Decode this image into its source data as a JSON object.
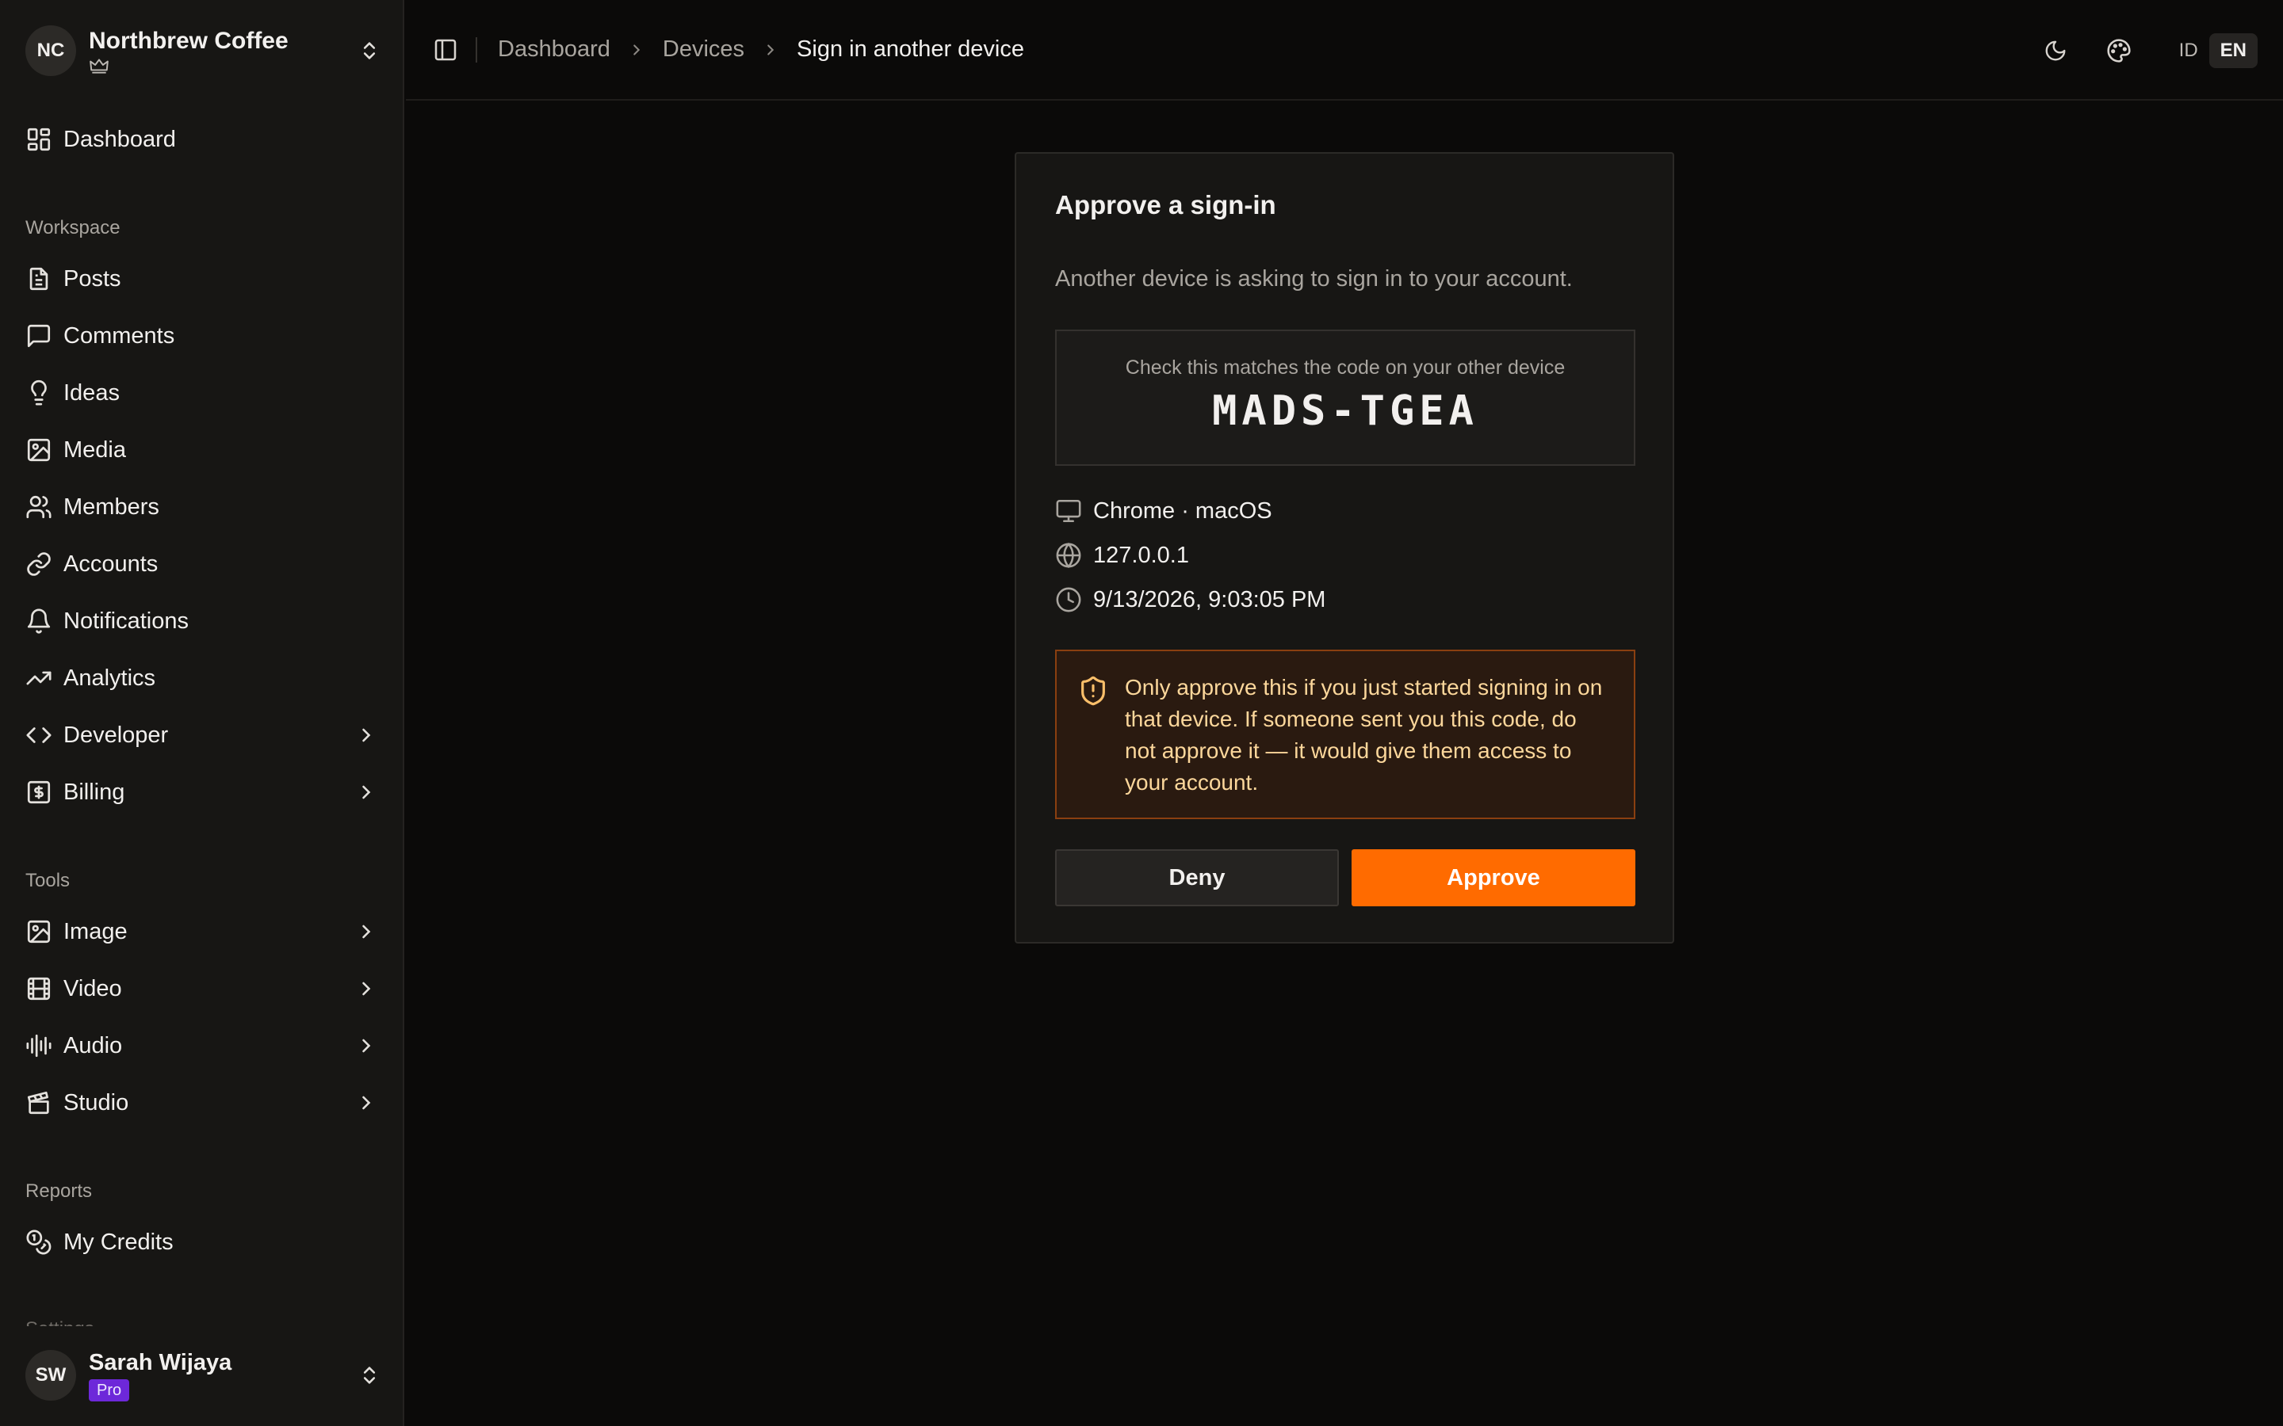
{
  "workspace": {
    "initials": "NC",
    "name": "Northbrew Coffee",
    "plan_icon": "crown-icon"
  },
  "sidebar": {
    "dashboard": "Dashboard",
    "sections": {
      "workspace": "Workspace",
      "tools": "Tools",
      "reports": "Reports",
      "cut_off": "Settings"
    },
    "workspace_items": [
      {
        "label": "Posts",
        "icon": "file-text-icon"
      },
      {
        "label": "Comments",
        "icon": "message-square-icon"
      },
      {
        "label": "Ideas",
        "icon": "lightbulb-icon"
      },
      {
        "label": "Media",
        "icon": "image-icon"
      },
      {
        "label": "Members",
        "icon": "users-icon"
      },
      {
        "label": "Accounts",
        "icon": "link-icon"
      },
      {
        "label": "Notifications",
        "icon": "bell-icon"
      },
      {
        "label": "Analytics",
        "icon": "trending-up-icon"
      },
      {
        "label": "Developer",
        "icon": "code-icon",
        "expandable": true
      },
      {
        "label": "Billing",
        "icon": "receipt-icon",
        "expandable": true
      }
    ],
    "tools_items": [
      {
        "label": "Image",
        "icon": "image-icon",
        "expandable": true
      },
      {
        "label": "Video",
        "icon": "film-icon",
        "expandable": true
      },
      {
        "label": "Audio",
        "icon": "audio-wave-icon",
        "expandable": true
      },
      {
        "label": "Studio",
        "icon": "clapperboard-icon",
        "expandable": true
      }
    ],
    "reports_items": [
      {
        "label": "My Credits",
        "icon": "coins-icon"
      }
    ]
  },
  "user": {
    "initials": "SW",
    "name": "Sarah Wijaya",
    "plan": "Pro"
  },
  "header": {
    "breadcrumbs": [
      "Dashboard",
      "Devices",
      "Sign in another device"
    ],
    "languages": [
      "ID",
      "EN"
    ],
    "active_language": "EN"
  },
  "card": {
    "title": "Approve a sign-in",
    "subtitle": "Another device is asking to sign in to your account.",
    "code_hint": "Check this matches the code on your other device",
    "code": "MADS-TGEA",
    "device": "Chrome · macOS",
    "ip": "127.0.0.1",
    "time": "9/13/2026, 9:03:05 PM",
    "warning": "Only approve this if you just started signing in on that device. If someone sent you this code, do not approve it — it would give them access to your account.",
    "deny_label": "Deny",
    "approve_label": "Approve"
  },
  "colors": {
    "accent": "#ff6b00",
    "warning_bg": "#2a1a10",
    "warning_text": "#fcd79b",
    "pro_badge": "#6d28d9"
  }
}
